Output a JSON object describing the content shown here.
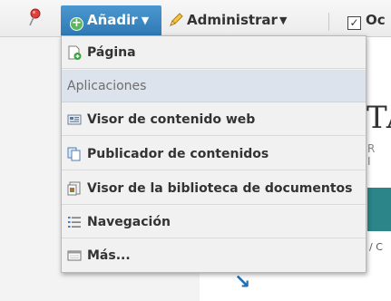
{
  "toolbar": {
    "pin_icon": "map-pin-icon",
    "add_label": "Añadir",
    "add_icon": "plus-circle-icon",
    "admin_label": "Administrar",
    "admin_icon": "pencil-icon",
    "hide_label": "Oc",
    "hide_icon": "checkbox-icon",
    "caret": "▼",
    "plus_glyph": "+",
    "check_glyph": "✓",
    "accent_color": "#2f7ab5"
  },
  "menu": {
    "items": [
      {
        "label": "Página",
        "icon": "page-add-icon"
      },
      {
        "label": "Aplicaciones",
        "type": "header"
      },
      {
        "label": "Visor de contenido web",
        "icon": "web-content-icon"
      },
      {
        "label": "Publicador de contenidos",
        "icon": "documents-icon"
      },
      {
        "label": "Visor de la biblioteca de documentos",
        "icon": "library-icon"
      },
      {
        "label": "Navegación",
        "icon": "list-icon"
      },
      {
        "label": "Más...",
        "icon": "window-icon"
      }
    ]
  },
  "background": {
    "title_fragment": "TA",
    "subtitle_fragment": "R I",
    "crumb_fragment": "/ C",
    "arrow_glyph": "↘"
  }
}
